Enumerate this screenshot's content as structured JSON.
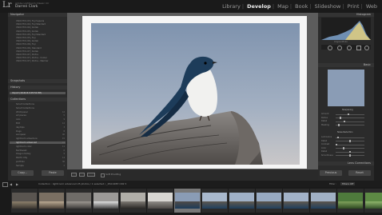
{
  "app": {
    "brand_small": "Adobe Lightroom Classic CC",
    "user": "Darren Clark",
    "modules": [
      "Library",
      "Develop",
      "Map",
      "Book",
      "Slideshow",
      "Print",
      "Web"
    ],
    "active_module": "Develop"
  },
  "left_panel": {
    "navigator_label": "Navigator",
    "presets_label": "Presets",
    "presets": [
      "VSCO Film 03 | Fuji Superia",
      "VSCO Film 04 | Fuji Standard",
      "VSCO Film 04 | Kodak",
      "VSCO Film 05 | Kodak",
      "VSCO Film 05 | Fuji Standard",
      "VSCO Film 05 | Fuji",
      "VSCO Film 06 | Kodak",
      "VSCO Film 06 | Fuji",
      "VSCO Film 06 | Standard",
      "VSCO Film 07 | Kodak",
      "VSCO Film 07 | Portra",
      "VSCO Film 07 | Portra - Cooler",
      "VSCO Film 07 | Portra - Warmer"
    ],
    "snapshots_label": "Snapshots",
    "history_label": "History",
    "history_item": "Import (4/16/16 9:05:52 PM)",
    "collections_label": "Collections",
    "collections": [
      {
        "name": "Smart Collections",
        "count": ""
      },
      {
        "name": "Smart Collections",
        "count": ""
      },
      {
        "name": "2019 panel",
        "count": "12"
      },
      {
        "name": "art pieces",
        "count": "5"
      },
      {
        "name": "cars",
        "count": "9"
      },
      {
        "name": "Edit",
        "count": "12"
      },
      {
        "name": "daytrips",
        "count": "3"
      },
      {
        "name": "Dogs",
        "count": "8"
      },
      {
        "name": "european",
        "count": "40"
      },
      {
        "name": "lightroom adventure",
        "count": "15"
      },
      {
        "name": "lightroom advanced",
        "count": "24"
      },
      {
        "name": "lightroom color",
        "count": "11"
      },
      {
        "name": "Northwest",
        "count": "6"
      },
      {
        "name": "Oregon family",
        "count": "9"
      },
      {
        "name": "Pacific City",
        "count": "14"
      },
      {
        "name": "portfolio",
        "count": "30"
      },
      {
        "name": "Sample",
        "count": "2"
      }
    ],
    "copy_button": "Copy...",
    "paste_button": "Paste"
  },
  "toolbar": {
    "soft_proofing": "Soft Proofing"
  },
  "right_panel": {
    "histogram_label": "Histogram",
    "original_label": "Original Photo",
    "basic_label": "Basic",
    "sharpening_label": "Sharpening",
    "noise_label": "Noise Reduction",
    "lens_label": "Lens Corrections",
    "rows": [
      "Amount",
      "Radius",
      "Detail",
      "Masking",
      "Luminance",
      "Detail",
      "Contrast",
      "Color",
      "Detail",
      "Smoothness"
    ],
    "previous_button": "Previous",
    "reset_button": "Reset"
  },
  "filmstrip": {
    "source_text": "Collection : lightroom advanced    25 photos / 1 selected / _DSC4987.CR2 ▾",
    "filter_label": "Filter :",
    "filter_value": "Filters Off"
  },
  "colors": {
    "accent": "#eeeeee",
    "background": "#222222",
    "panel": "#2b2b2b",
    "sky": "#8a9cb5"
  }
}
